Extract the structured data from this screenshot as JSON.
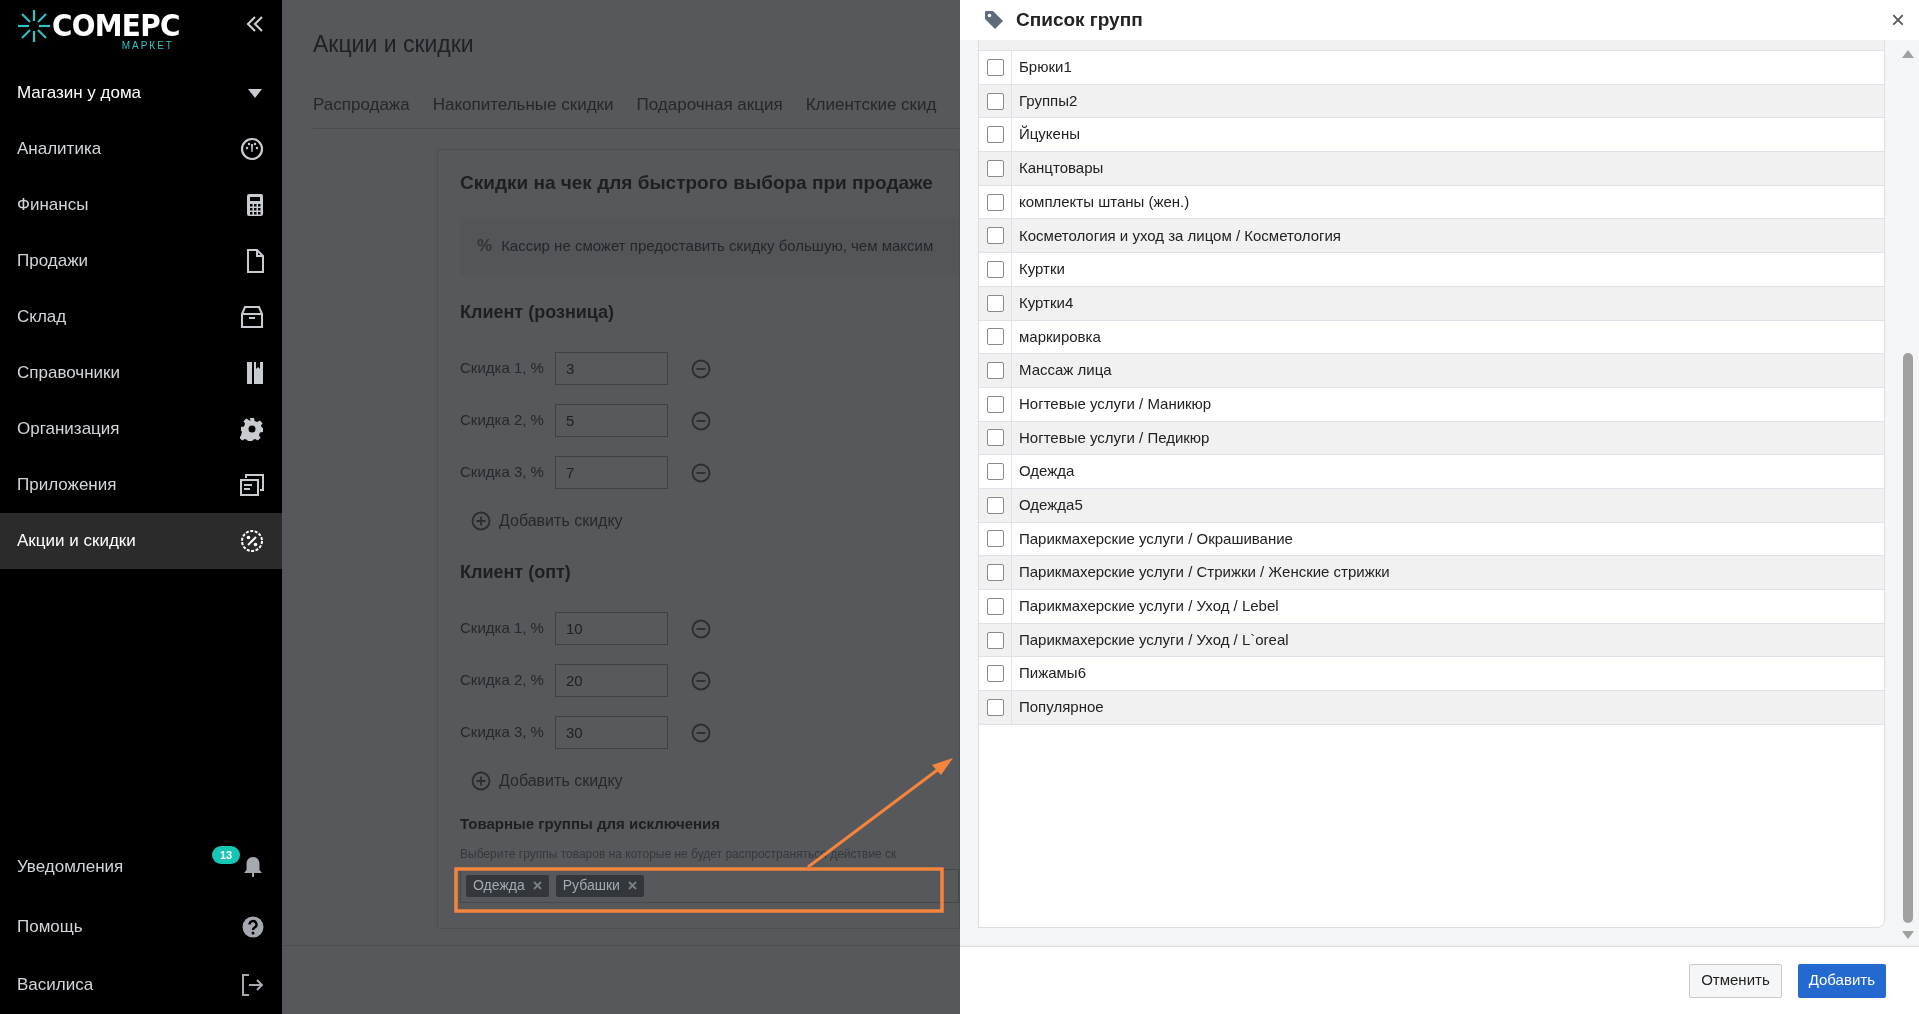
{
  "sidebar": {
    "logo": {
      "name": "COMEPC",
      "sub": "МАРКЕТ"
    },
    "store": "Магазин у дома",
    "items": [
      {
        "label": "Аналитика",
        "selected": false
      },
      {
        "label": "Финансы",
        "selected": false
      },
      {
        "label": "Продажи",
        "selected": false
      },
      {
        "label": "Склад",
        "selected": false
      },
      {
        "label": "Справочники",
        "selected": false
      },
      {
        "label": "Организация",
        "selected": false
      },
      {
        "label": "Приложения",
        "selected": false
      },
      {
        "label": "Акции и скидки",
        "selected": true
      }
    ],
    "bottom_items": [
      {
        "label": "Уведомления",
        "badge": "13"
      },
      {
        "label": "Помощь"
      },
      {
        "label": "Василиса"
      }
    ]
  },
  "page": {
    "title": "Акции и скидки",
    "tabs": [
      "Распродажа",
      "Накопительные скидки",
      "Подарочная акция",
      "Клиентские скид"
    ],
    "card": {
      "title": "Скидки на чек для быстрого выбора при продаже",
      "info_icon": "%",
      "info": "Кассир не сможет предоставить скидку большую, чем максим",
      "groups": [
        {
          "title": "Клиент (розница)",
          "discounts": [
            {
              "label": "Скидка 1, %",
              "value": "3"
            },
            {
              "label": "Скидка 2, %",
              "value": "5"
            },
            {
              "label": "Скидка 3, %",
              "value": "7"
            }
          ],
          "add": "Добавить скидку"
        },
        {
          "title": "Клиент (опт)",
          "discounts": [
            {
              "label": "Скидка 1, %",
              "value": "10"
            },
            {
              "label": "Скидка 2, %",
              "value": "20"
            },
            {
              "label": "Скидка 3, %",
              "value": "30"
            }
          ],
          "add": "Добавить скидку"
        }
      ],
      "exclusions": {
        "title": "Товарные группы для исключения",
        "hint": "Выберите группы товаров на которые не будет распространяться действие ск",
        "tags": [
          "Одежда",
          "Рубашки"
        ]
      }
    }
  },
  "dialog": {
    "title": "Список групп",
    "close": "×",
    "rows": [
      {
        "label": "Брюки1",
        "checked": false
      },
      {
        "label": "Группы2",
        "checked": false
      },
      {
        "label": "Йцукены",
        "checked": false
      },
      {
        "label": "Канцтовары",
        "checked": false
      },
      {
        "label": "комплекты штаны (жен.)",
        "checked": false
      },
      {
        "label": "Косметология и уход за лицом / Косметология",
        "checked": false
      },
      {
        "label": "Куртки",
        "checked": false
      },
      {
        "label": "Куртки4",
        "checked": false
      },
      {
        "label": "маркировка",
        "checked": false
      },
      {
        "label": "Массаж лица",
        "checked": false
      },
      {
        "label": "Ногтевые услуги / Маникюр",
        "checked": false
      },
      {
        "label": "Ногтевые услуги / Педикюр",
        "checked": false
      },
      {
        "label": "Одежда",
        "checked": false
      },
      {
        "label": "Одежда5",
        "checked": false
      },
      {
        "label": "Парикмахерские услуги / Окрашивание",
        "checked": false
      },
      {
        "label": "Парикмахерские услуги / Стрижки / Женские стрижки",
        "checked": false
      },
      {
        "label": "Парикмахерские услуги / Уход / Lebel",
        "checked": false
      },
      {
        "label": "Парикмахерские услуги / Уход / L`oreal",
        "checked": false
      },
      {
        "label": "Пижамы6",
        "checked": false
      },
      {
        "label": "Популярное",
        "checked": false
      }
    ],
    "buttons": {
      "cancel": "Отменить",
      "ok": "Добавить"
    }
  }
}
